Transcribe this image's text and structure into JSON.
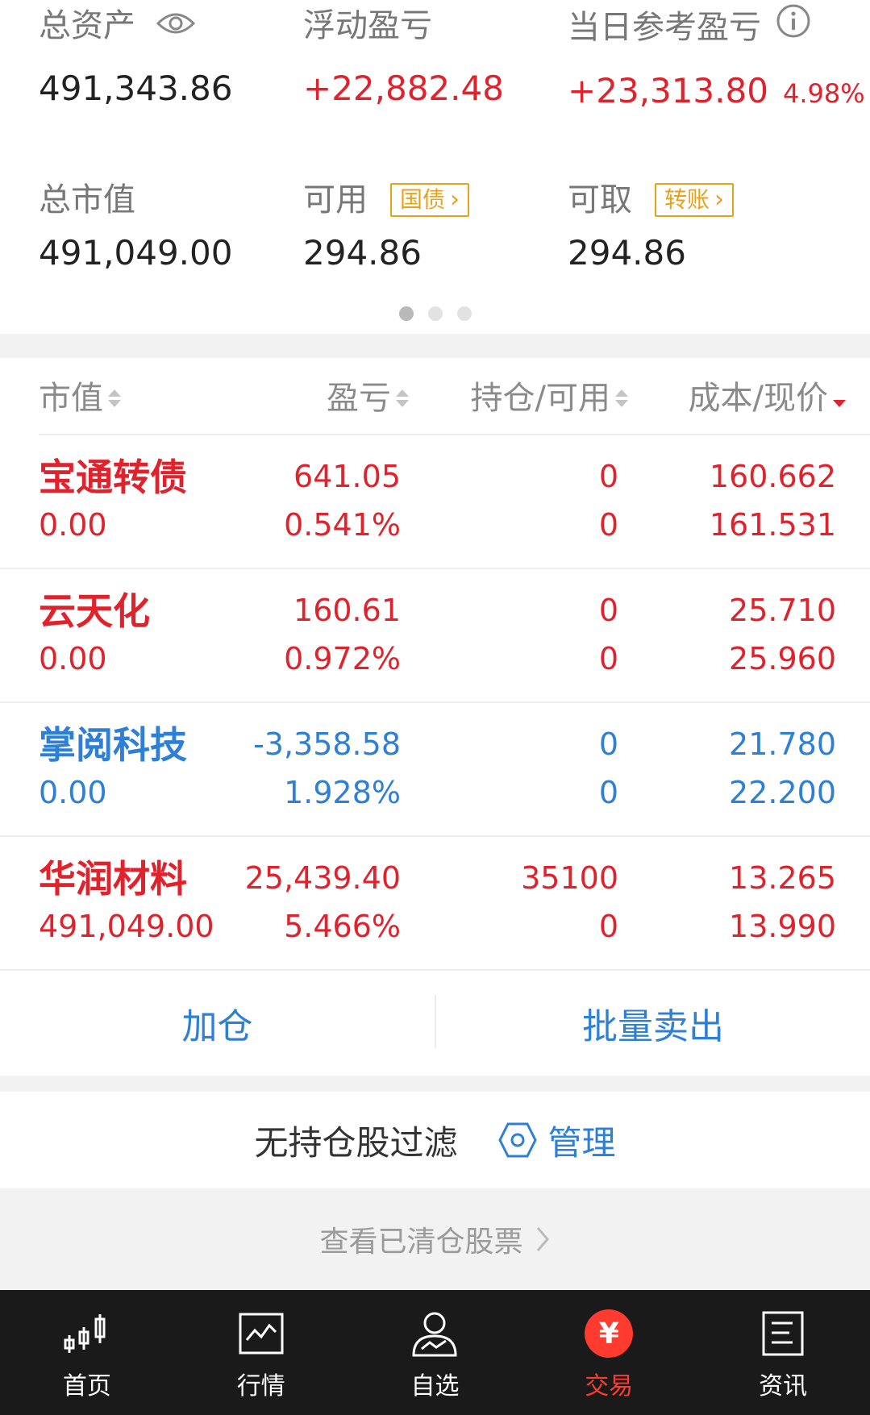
{
  "summary": {
    "total_assets_label": "总资产",
    "total_assets_value": "491,343.86",
    "floating_pl_label": "浮动盈亏",
    "floating_pl_value": "+22,882.48",
    "daily_pl_label": "当日参考盈亏",
    "daily_pl_value": "+23,313.80",
    "daily_pl_pct": "4.98%",
    "market_value_label": "总市值",
    "market_value_value": "491,049.00",
    "available_label": "可用",
    "available_tag": "国债",
    "available_value": "294.86",
    "withdrawable_label": "可取",
    "withdrawable_tag": "转账",
    "withdrawable_value": "294.86"
  },
  "pager": {
    "pages": 3,
    "active": 0
  },
  "table": {
    "headers": [
      "市值",
      "盈亏",
      "持仓/可用",
      "成本/现价"
    ],
    "rows": [
      {
        "name": "宝通转债",
        "market_value": "0.00",
        "pl": "641.05",
        "pl_pct": "0.541%",
        "position": "0",
        "available": "0",
        "cost": "160.662",
        "price": "161.531",
        "color": "red"
      },
      {
        "name": "云天化",
        "market_value": "0.00",
        "pl": "160.61",
        "pl_pct": "0.972%",
        "position": "0",
        "available": "0",
        "cost": "25.710",
        "price": "25.960",
        "color": "red"
      },
      {
        "name": "掌阅科技",
        "market_value": "0.00",
        "pl": "-3,358.58",
        "pl_pct": "1.928%",
        "position": "0",
        "available": "0",
        "cost": "21.780",
        "price": "22.200",
        "color": "blue"
      },
      {
        "name": "华润材料",
        "market_value": "491,049.00",
        "pl": "25,439.40",
        "pl_pct": "5.466%",
        "position": "35100",
        "available": "0",
        "cost": "13.265",
        "price": "13.990",
        "color": "red"
      }
    ]
  },
  "actions": {
    "add_label": "加仓",
    "batch_sell_label": "批量卖出"
  },
  "filter": {
    "label": "无持仓股过滤",
    "manage_label": "管理"
  },
  "cleared": {
    "label": "查看已清仓股票"
  },
  "nav": {
    "items": [
      {
        "label": "首页",
        "icon": "candlestick-icon"
      },
      {
        "label": "行情",
        "icon": "chart-icon"
      },
      {
        "label": "自选",
        "icon": "user-chart-icon"
      },
      {
        "label": "交易",
        "icon": "yen-icon"
      },
      {
        "label": "资讯",
        "icon": "news-icon"
      }
    ],
    "active": 3
  },
  "colors": {
    "up": "#e0222c",
    "down": "#2e7fd6",
    "tag": "#e8a21a",
    "nav_bg": "#1a1a1a",
    "nav_active": "#ff3b30"
  }
}
